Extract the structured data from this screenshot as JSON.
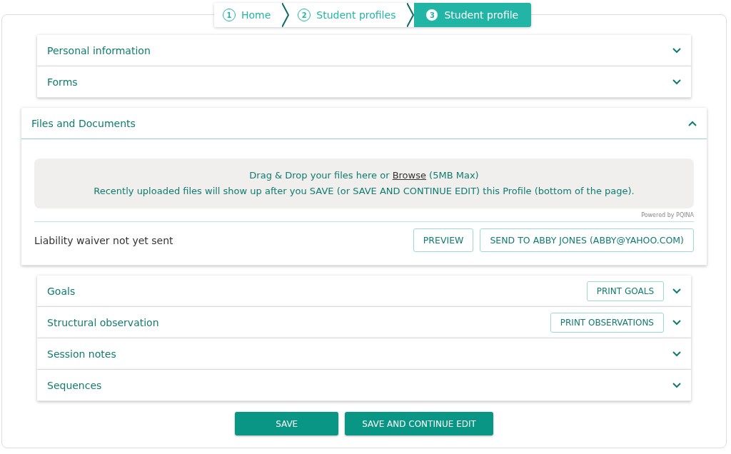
{
  "breadcrumb": [
    {
      "number": "1",
      "label": "Home",
      "selected": false
    },
    {
      "number": "2",
      "label": "Student profiles",
      "selected": false
    },
    {
      "number": "3",
      "label": "Student profile",
      "selected": true
    }
  ],
  "sections": [
    {
      "title": "Personal information",
      "expanded": false
    },
    {
      "title": "Forms",
      "expanded": false
    },
    {
      "title": "Files and Documents",
      "expanded": true
    },
    {
      "title": "Goals",
      "expanded": false,
      "button": "PRINT GOALS"
    },
    {
      "title": "Structural observation",
      "expanded": false,
      "button": "PRINT OBSERVATIONS"
    },
    {
      "title": "Session notes",
      "expanded": false
    },
    {
      "title": "Sequences",
      "expanded": false
    }
  ],
  "files": {
    "drop_zone": {
      "line_1_start": "Drag & Drop your files here or ",
      "browse_link": "Browse",
      "line_1_end": " (5MB Max)",
      "line_2": "Recently uploaded files will show up after you SAVE (or SAVE AND CONTINUE EDIT) this Profile (bottom of the page)."
    },
    "credit": "Powered by PQINA",
    "waiver_status": "Liability waiver not yet sent",
    "buttons": [
      "PREVIEW",
      "SEND TO ABBY JONES (ABBY@YAHOO.COM)"
    ]
  },
  "footer_buttons": [
    "SAVE",
    "SAVE AND CONTINUE EDIT"
  ]
}
